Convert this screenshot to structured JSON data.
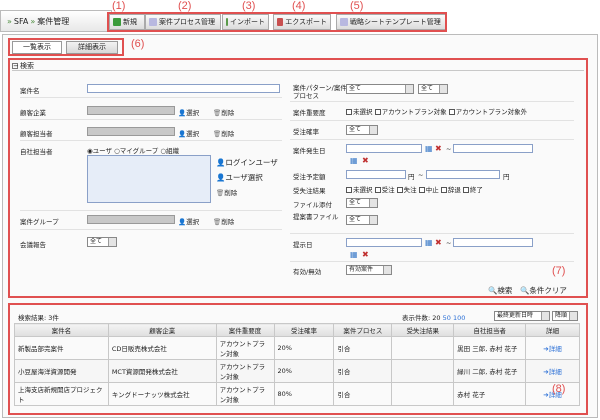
{
  "breadcrumb": {
    "root": "SFA",
    "page": "案件管理"
  },
  "toolbar": {
    "new": "新規",
    "process": "案件プロセス管理",
    "import": "インポート",
    "export": "エクスポート",
    "template": "戦略シートテンプレート管理"
  },
  "annotations": [
    "(1)",
    "(2)",
    "(3)",
    "(4)",
    "(5)",
    "(6)",
    "(7)",
    "(8)"
  ],
  "tabs": {
    "list": "一覧表示",
    "detail": "詳細表示"
  },
  "search": {
    "title": "検索",
    "name_label": "案件名",
    "customer_label": "顧客企業",
    "contact_label": "顧客担当者",
    "owner_label": "自社担当者",
    "group_label": "案件グループ",
    "meeting_label": "会議報告",
    "select": "選択",
    "delete": "削除",
    "login_user": "ログインユーザ",
    "user_select": "ユーザ選択",
    "radio_user": "ユーザ",
    "radio_mygroup": "マイグループ",
    "radio_org": "組織",
    "all": "全て",
    "pattern_label": "案件パターン/案件プロセス",
    "importance_label": "案件重要度",
    "importance_opts": [
      "未選択",
      "アカウントプラン対象",
      "アカウントプラン対象外"
    ],
    "prob_label": "受注確率",
    "date_label": "案件発生日",
    "tilde": "~",
    "amount_label": "受注予定額",
    "yen": "円",
    "result_label": "受失注結果",
    "result_opts": [
      "未選択",
      "受注",
      "失注",
      "中止",
      "辞退",
      "終了"
    ],
    "file_label": "ファイル添付",
    "proposal_label": "提案書ファイル",
    "present_label": "提示日",
    "valid_label": "有効/無効",
    "valid_value": "有効案件",
    "search_btn": "検索",
    "clear_btn": "条件クリア"
  },
  "results": {
    "count_label": "検索結果: 3件",
    "per_page_label": "表示件数:",
    "per_page_opts": [
      "20",
      "50",
      "100"
    ],
    "sort_value": "最終更新日時",
    "order_value": "降順",
    "headers": [
      "案件名",
      "顧客企業",
      "案件重要度",
      "受注確率",
      "案件プロセス",
      "受失注結果",
      "自社担当者",
      "詳細"
    ],
    "rows": [
      {
        "name": "新製品部完案件",
        "customer": "CD日販売株式会社",
        "importance": "アカウントプラン対象",
        "prob": "20%",
        "process": "引合",
        "result": "",
        "owner": "黒田 三郎, 赤村 花子",
        "detail": "詳細"
      },
      {
        "name": "小豆屋海洋資源開発",
        "customer": "MCT資源開発株式会社",
        "importance": "アカウントプラン対象",
        "prob": "20%",
        "process": "引合",
        "result": "",
        "owner": "緑川 二郎, 赤村 花子",
        "detail": "詳細"
      },
      {
        "name": "上海支店新規開店プロジェクト",
        "customer": "キングドーナッツ株式会社",
        "importance": "アカウントプラン対象",
        "prob": "80%",
        "process": "引合",
        "result": "",
        "owner": "赤村 花子",
        "detail": "詳細"
      }
    ]
  },
  "colors": {
    "annotation": "#e05050",
    "link": "#2a6fd6",
    "accent": "#3a7a3a"
  }
}
